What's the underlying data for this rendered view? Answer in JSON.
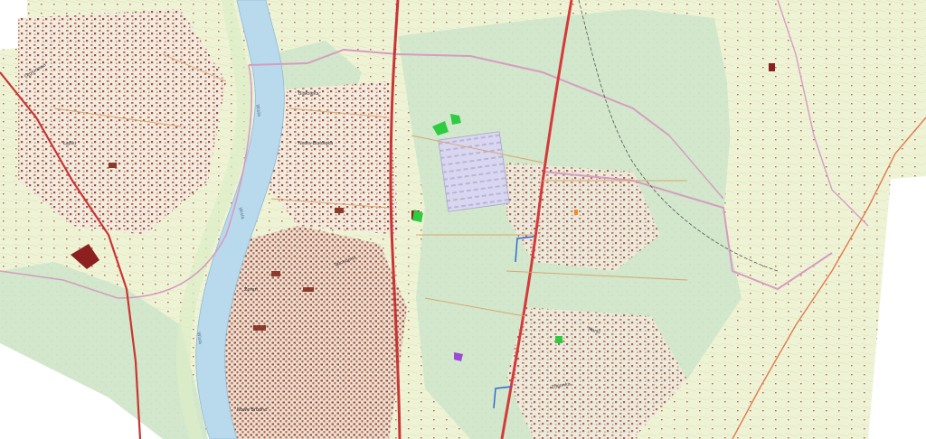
{
  "map": {
    "colors": {
      "background_blank": "#ffffff",
      "land_open": "#e8efcf",
      "forest": "#cfe5c8",
      "water": "#b9d9ec",
      "built_up": "#eee7dc",
      "building": "#8c3a2b",
      "main_road": "#d43a3a",
      "boundary": "#d79cc1",
      "industrial": "#d6d4ec"
    },
    "labels": {
      "river_north": "Wisła",
      "river_middle": "Wisła",
      "river_south": "Wisła",
      "district_nw": "Legionowo",
      "district_west_centre": "Łajski",
      "district_centre_1": "Białołęka",
      "district_centre_2": "Nowa Białołęka",
      "district_centre_3": "Tarchomin",
      "district_south": "Nowe Bródno",
      "district_sw": "Żerań",
      "district_east": "Marki",
      "district_se": "Zielonka"
    },
    "markers": [
      {
        "name": "green-area-north",
        "color": "#2ecc40"
      },
      {
        "name": "green-area-centre",
        "color": "#2ecc40"
      },
      {
        "name": "purple-area",
        "color": "#9b4bd6"
      },
      {
        "name": "orange-spot",
        "color": "#f28c28"
      },
      {
        "name": "blue-route-north",
        "color": "#2a62d6"
      },
      {
        "name": "blue-route-south",
        "color": "#2a62d6"
      }
    ]
  }
}
